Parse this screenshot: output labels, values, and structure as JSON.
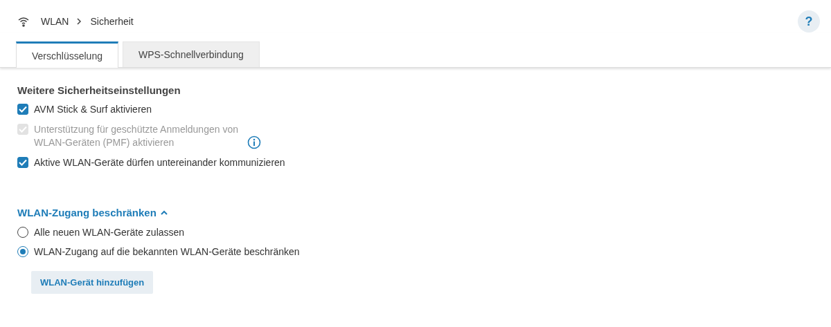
{
  "breadcrumb": {
    "items": [
      "WLAN",
      "Sicherheit"
    ]
  },
  "help_button": {
    "label": "?"
  },
  "tabs": [
    {
      "label": "Verschlüsselung",
      "selected": true
    },
    {
      "label": "WPS-Schnellverbindung",
      "selected": false
    }
  ],
  "section": {
    "title": "Weitere Sicherheitseinstellungen",
    "checkboxes": [
      {
        "label": "AVM Stick & Surf aktivieren",
        "checked": true,
        "disabled": false,
        "info": false
      },
      {
        "label": "Unterstützung für geschützte Anmeldungen von WLAN-Geräten (PMF) aktivieren",
        "checked": true,
        "disabled": true,
        "info": true
      },
      {
        "label": "Aktive WLAN-Geräte dürfen untereinander kommunizieren",
        "checked": true,
        "disabled": false,
        "info": false
      }
    ]
  },
  "access": {
    "title": "WLAN-Zugang beschränken",
    "expanded": true,
    "options": [
      {
        "label": "Alle neuen WLAN-Geräte zulassen",
        "selected": false
      },
      {
        "label": "WLAN-Zugang auf die bekannten WLAN-Geräte beschränken",
        "selected": true
      }
    ],
    "button": "WLAN-Gerät hinzufügen"
  }
}
